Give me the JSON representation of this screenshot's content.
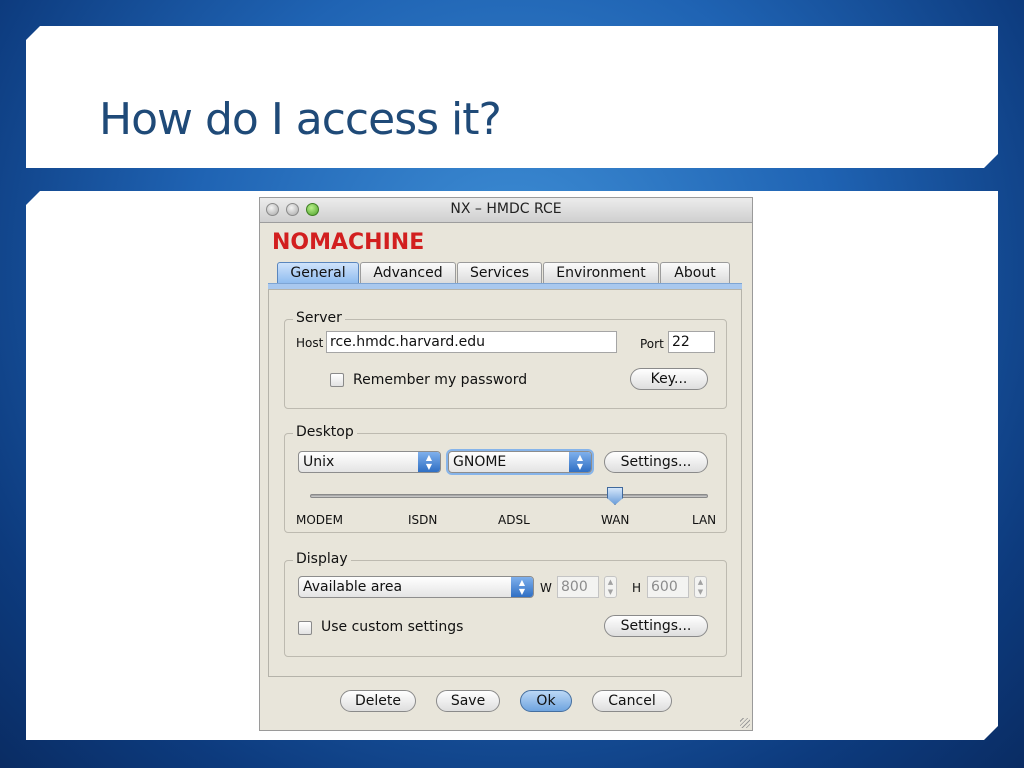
{
  "slide": {
    "title": "How do I access it?"
  },
  "window": {
    "title": "NX – HMDC RCE",
    "logo": "NOMACHINE",
    "tabs": [
      "General",
      "Advanced",
      "Services",
      "Environment",
      "About"
    ],
    "active_tab": "General",
    "server": {
      "legend": "Server",
      "host_label": "Host",
      "host_value": "rce.hmdc.harvard.edu",
      "port_label": "Port",
      "port_value": "22",
      "remember_label": "Remember my password",
      "remember_checked": false,
      "key_button": "Key..."
    },
    "desktop": {
      "legend": "Desktop",
      "os_value": "Unix",
      "session_value": "GNOME",
      "settings_button": "Settings...",
      "speed_labels": [
        "MODEM",
        "ISDN",
        "ADSL",
        "WAN",
        "LAN"
      ],
      "speed_selected": "WAN"
    },
    "display": {
      "legend": "Display",
      "size_value": "Available area",
      "w_label": "W",
      "w_value": "800",
      "h_label": "H",
      "h_value": "600",
      "custom_label": "Use custom settings",
      "custom_checked": false,
      "settings_button": "Settings..."
    },
    "buttons": {
      "delete": "Delete",
      "save": "Save",
      "ok": "Ok",
      "cancel": "Cancel"
    }
  },
  "colors": {
    "slide_title": "#1f4a78",
    "logo_red": "#d21f1f",
    "dialog_bg": "#e8e5da",
    "active_blue": "#6fa4df"
  }
}
